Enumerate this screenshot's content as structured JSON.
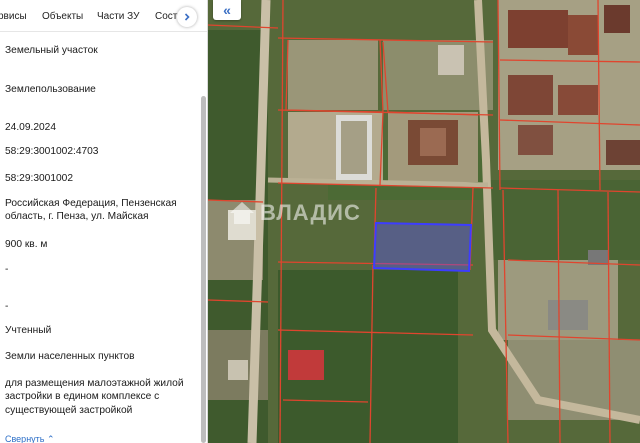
{
  "tabs": [
    {
      "label": "рвисы"
    },
    {
      "label": "Объекты"
    },
    {
      "label": "Части ЗУ"
    },
    {
      "label": "Соста"
    }
  ],
  "tab_next_icon": "chevron-right-icon",
  "details": [
    "Земельный участок",
    "Землепользование",
    "24.09.2024",
    "58:29:3001002:4703",
    "58:29:3001002",
    "Российская Федерация, Пензенская область, г. Пенза, ул. Майская",
    "900 кв. м",
    "-",
    "-",
    "Учтенный",
    "Земли населенных пунктов",
    "для размещения малоэтажной жилой застройки в едином комплексе с существующей застройкой"
  ],
  "more_link": "Свернуть ⌃",
  "map": {
    "collapse_icon": "double-chevron-left-icon",
    "collapse_label": "«",
    "watermark": "ВЛАДИС",
    "parcel_color": "#3d3dff",
    "boundary_color": "#e0452e"
  }
}
